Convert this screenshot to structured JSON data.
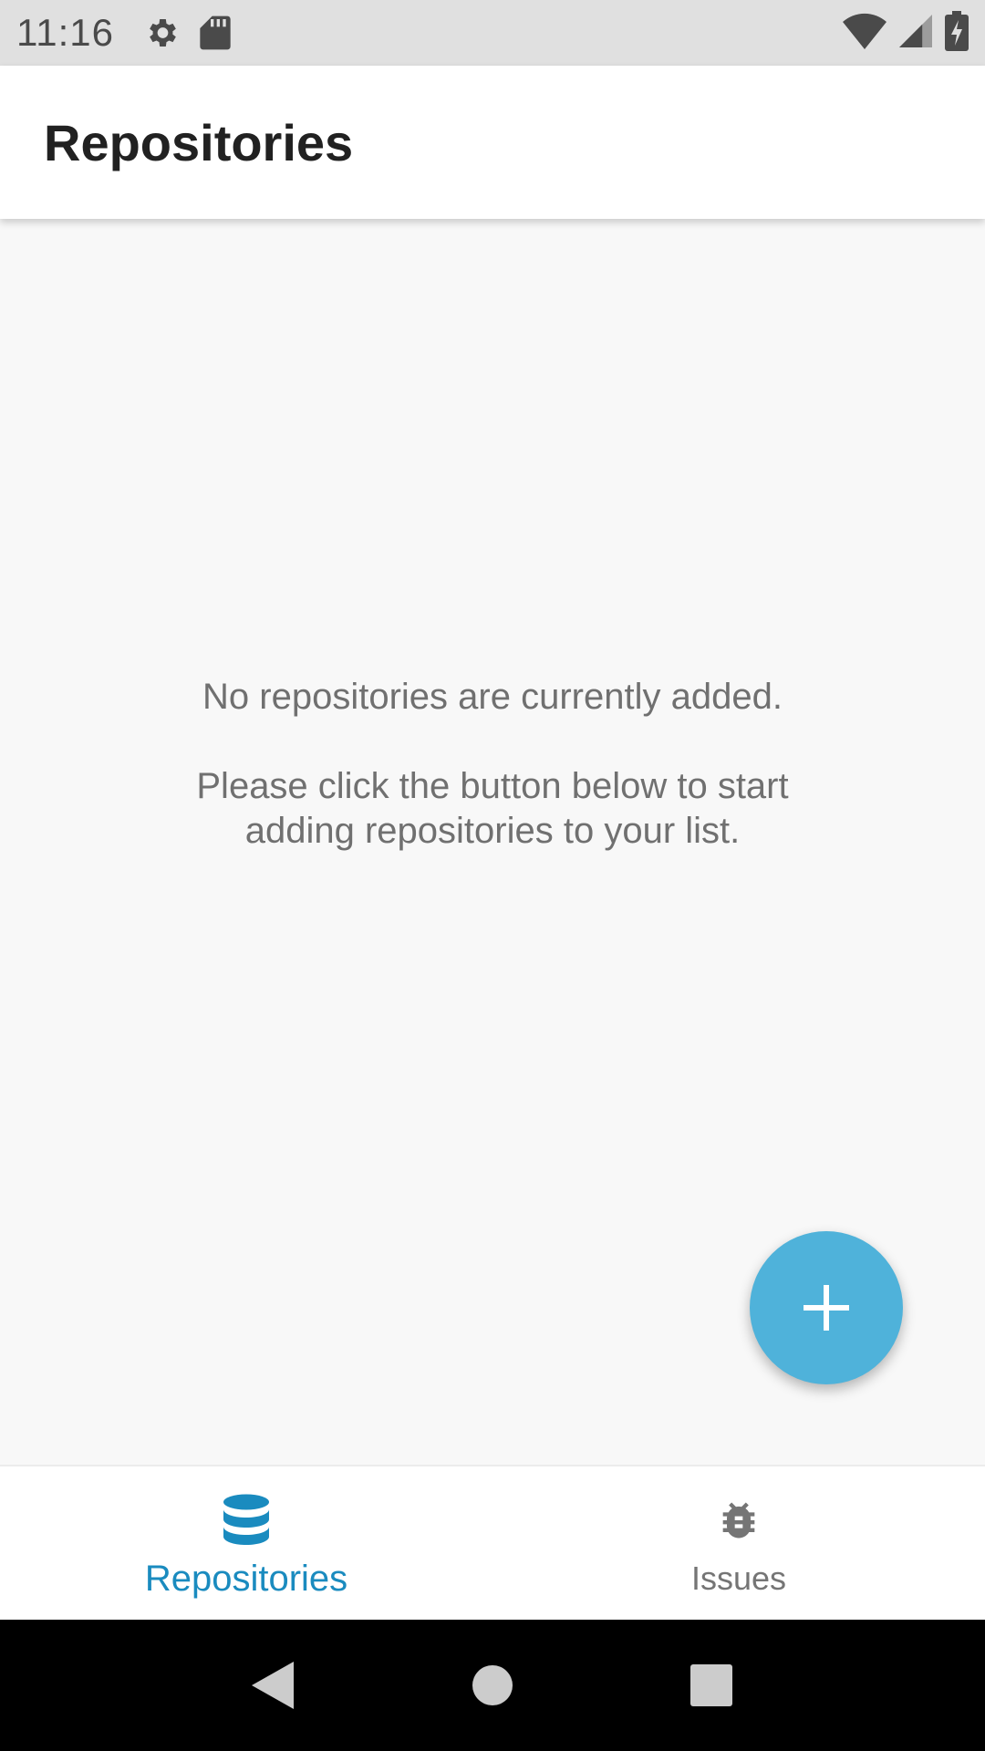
{
  "status_bar": {
    "time": "11:16",
    "left_icons": [
      "gear-icon",
      "sd-card-icon"
    ],
    "right_icons": [
      "wifi-icon",
      "signal-icon",
      "battery-charging-icon"
    ]
  },
  "app_bar": {
    "title": "Repositories"
  },
  "empty_state": {
    "primary": "No repositories are currently added.",
    "secondary": "Please click the button below to start adding repositories to your list."
  },
  "fab": {
    "icon": "plus-icon",
    "color": "#4fb2da"
  },
  "bottom_nav": {
    "active_color": "#1a8bbf",
    "inactive_color": "#757575",
    "items": [
      {
        "label": "Repositories",
        "icon": "database-icon",
        "active": true
      },
      {
        "label": "Issues",
        "icon": "bug-icon",
        "active": false
      }
    ]
  },
  "system_nav": {
    "buttons": [
      "back-icon",
      "home-icon",
      "recents-icon"
    ]
  }
}
